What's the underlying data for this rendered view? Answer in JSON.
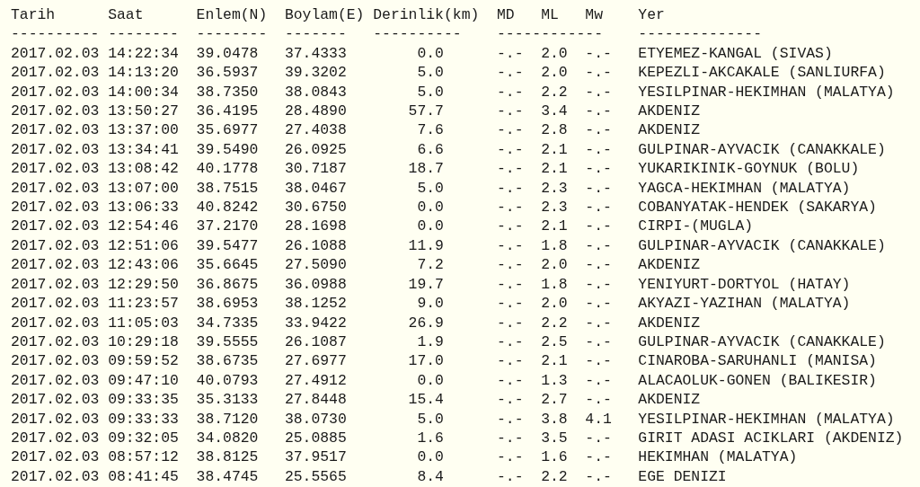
{
  "columns": [
    "Tarih",
    "Saat",
    "Enlem(N)",
    "Boylam(E)",
    "Derinlik(km)",
    "MD",
    "ML",
    "Mw",
    "Yer"
  ],
  "separators": [
    "----------",
    "--------",
    "--------",
    "-------",
    "----------",
    "------------",
    "--------------"
  ],
  "rows": [
    [
      "2017.02.03",
      "14:22:34",
      "39.0478",
      "37.4333",
      "0.0",
      "-.-",
      "2.0",
      "-.-",
      "ETYEMEZ-KANGAL (SIVAS)"
    ],
    [
      "2017.02.03",
      "14:13:20",
      "36.5937",
      "39.3202",
      "5.0",
      "-.-",
      "2.0",
      "-.-",
      "KEPEZLI-AKCAKALE (SANLIURFA)"
    ],
    [
      "2017.02.03",
      "14:00:34",
      "38.7350",
      "38.0843",
      "5.0",
      "-.-",
      "2.2",
      "-.-",
      "YESILPINAR-HEKIMHAN (MALATYA)"
    ],
    [
      "2017.02.03",
      "13:50:27",
      "36.4195",
      "28.4890",
      "57.7",
      "-.-",
      "3.4",
      "-.-",
      "AKDENIZ"
    ],
    [
      "2017.02.03",
      "13:37:00",
      "35.6977",
      "27.4038",
      "7.6",
      "-.-",
      "2.8",
      "-.-",
      "AKDENIZ"
    ],
    [
      "2017.02.03",
      "13:34:41",
      "39.5490",
      "26.0925",
      "6.6",
      "-.-",
      "2.1",
      "-.-",
      "GULPINAR-AYVACIK (CANAKKALE)"
    ],
    [
      "2017.02.03",
      "13:08:42",
      "40.1778",
      "30.7187",
      "18.7",
      "-.-",
      "2.1",
      "-.-",
      "YUKARIKINIK-GOYNUK (BOLU)"
    ],
    [
      "2017.02.03",
      "13:07:00",
      "38.7515",
      "38.0467",
      "5.0",
      "-.-",
      "2.3",
      "-.-",
      "YAGCA-HEKIMHAN (MALATYA)"
    ],
    [
      "2017.02.03",
      "13:06:33",
      "40.8242",
      "30.6750",
      "0.0",
      "-.-",
      "2.3",
      "-.-",
      "COBANYATAK-HENDEK (SAKARYA)"
    ],
    [
      "2017.02.03",
      "12:54:46",
      "37.2170",
      "28.1698",
      "0.0",
      "-.-",
      "2.1",
      "-.-",
      "CIRPI-(MUGLA)"
    ],
    [
      "2017.02.03",
      "12:51:06",
      "39.5477",
      "26.1088",
      "11.9",
      "-.-",
      "1.8",
      "-.-",
      "GULPINAR-AYVACIK (CANAKKALE)"
    ],
    [
      "2017.02.03",
      "12:43:06",
      "35.6645",
      "27.5090",
      "7.2",
      "-.-",
      "2.0",
      "-.-",
      "AKDENIZ"
    ],
    [
      "2017.02.03",
      "12:29:50",
      "36.8675",
      "36.0988",
      "19.7",
      "-.-",
      "1.8",
      "-.-",
      "YENIYURT-DORTYOL (HATAY)"
    ],
    [
      "2017.02.03",
      "11:23:57",
      "38.6953",
      "38.1252",
      "9.0",
      "-.-",
      "2.0",
      "-.-",
      "AKYAZI-YAZIHAN (MALATYA)"
    ],
    [
      "2017.02.03",
      "11:05:03",
      "34.7335",
      "33.9422",
      "26.9",
      "-.-",
      "2.2",
      "-.-",
      "AKDENIZ"
    ],
    [
      "2017.02.03",
      "10:29:18",
      "39.5555",
      "26.1087",
      "1.9",
      "-.-",
      "2.5",
      "-.-",
      "GULPINAR-AYVACIK (CANAKKALE)"
    ],
    [
      "2017.02.03",
      "09:59:52",
      "38.6735",
      "27.6977",
      "17.0",
      "-.-",
      "2.1",
      "-.-",
      "CINAROBA-SARUHANLI (MANISA)"
    ],
    [
      "2017.02.03",
      "09:47:10",
      "40.0793",
      "27.4912",
      "0.0",
      "-.-",
      "1.3",
      "-.-",
      "ALACAOLUK-GONEN (BALIKESIR)"
    ],
    [
      "2017.02.03",
      "09:33:35",
      "35.3133",
      "27.8448",
      "15.4",
      "-.-",
      "2.7",
      "-.-",
      "AKDENIZ"
    ],
    [
      "2017.02.03",
      "09:33:33",
      "38.7120",
      "38.0730",
      "5.0",
      "-.-",
      "3.8",
      "4.1",
      "YESILPINAR-HEKIMHAN (MALATYA)"
    ],
    [
      "2017.02.03",
      "09:32:05",
      "34.0820",
      "25.0885",
      "1.6",
      "-.-",
      "3.5",
      "-.-",
      "GIRIT ADASI ACIKLARI (AKDENIZ)"
    ],
    [
      "2017.02.03",
      "08:57:12",
      "38.8125",
      "37.9517",
      "0.0",
      "-.-",
      "1.6",
      "-.-",
      "HEKIMHAN (MALATYA)"
    ],
    [
      "2017.02.03",
      "08:41:45",
      "38.4745",
      "25.5565",
      "8.4",
      "-.-",
      "2.2",
      "-.-",
      "EGE DENIZI"
    ]
  ]
}
